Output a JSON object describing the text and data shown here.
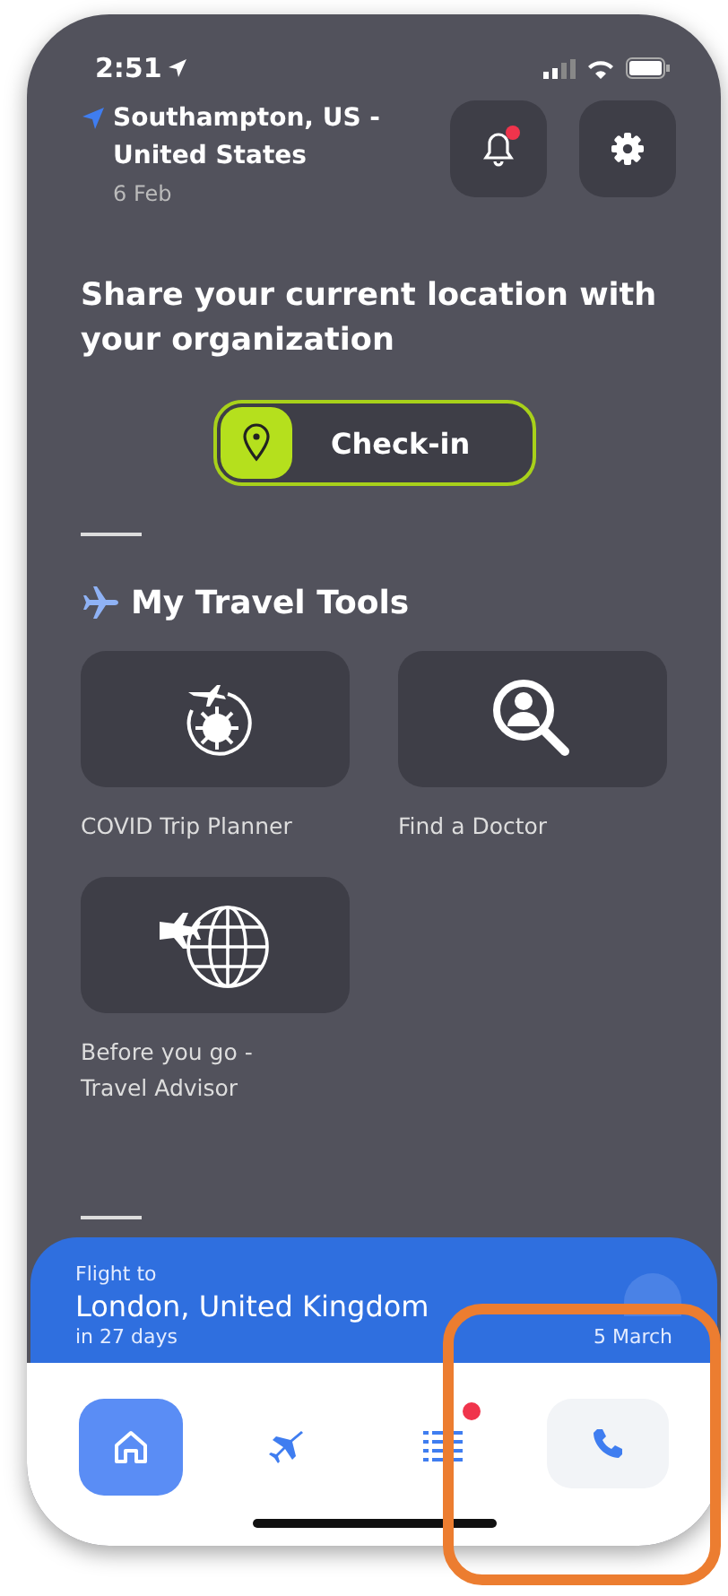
{
  "status_bar": {
    "time": "2:51"
  },
  "location": {
    "place": "Southampton, US - United States",
    "date": "6 Feb"
  },
  "header_buttons": [
    {
      "kind": "bell",
      "badge": true
    },
    {
      "kind": "gear",
      "badge": false
    }
  ],
  "share_prompt": "Share your current location with your organization",
  "check_in": {
    "label": "Check-in"
  },
  "travel_tools": {
    "title": "My Travel Tools",
    "tools": [
      {
        "kind": "covid",
        "label": "COVID Trip Planner"
      },
      {
        "kind": "doctor",
        "label": "Find a Doctor"
      },
      {
        "kind": "globe",
        "label": "Before you go - Travel Advisor"
      }
    ]
  },
  "flight": {
    "caption": "Flight to",
    "destination": "London, United Kingdom",
    "countdown": "in 27 days",
    "date": "5 March"
  },
  "nav": [
    {
      "kind": "home",
      "selected": true,
      "badge": false,
      "pressed": false
    },
    {
      "kind": "plane",
      "selected": false,
      "badge": false,
      "pressed": false
    },
    {
      "kind": "list",
      "selected": false,
      "badge": true,
      "pressed": false
    },
    {
      "kind": "phone",
      "selected": false,
      "badge": false,
      "pressed": true
    }
  ]
}
